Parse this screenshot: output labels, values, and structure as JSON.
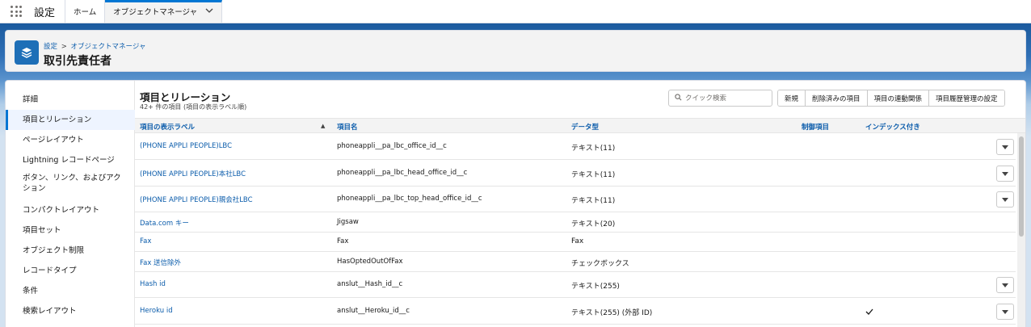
{
  "topnav": {
    "app_name": "設定",
    "tabs": [
      {
        "label": "ホーム"
      },
      {
        "label": "オブジェクトマネージャ"
      }
    ]
  },
  "page": {
    "breadcrumb": {
      "settings": "設定",
      "separator": ">",
      "object_manager": "オブジェクトマネージャ"
    },
    "title": "取引先責任者"
  },
  "sidebar": {
    "items": [
      {
        "label": "詳細"
      },
      {
        "label": "項目とリレーション"
      },
      {
        "label": "ページレイアウト"
      },
      {
        "label": "Lightning レコードページ"
      },
      {
        "label": "ボタン、リンク、およびアクション"
      },
      {
        "label": "コンパクトレイアウト"
      },
      {
        "label": "項目セット"
      },
      {
        "label": "オブジェクト制限"
      },
      {
        "label": "レコードタイプ"
      },
      {
        "label": "条件"
      },
      {
        "label": "検索レイアウト"
      }
    ],
    "active_index": 1
  },
  "section": {
    "title": "項目とリレーション",
    "subtitle": "42+ 件の項目 (項目の表示ラベル順)",
    "search_placeholder": "クイック検索",
    "buttons": {
      "new": "新規",
      "deleted_fields": "削除済みの項目",
      "dependencies": "項目の連動関係",
      "history": "項目履歴管理の設定"
    }
  },
  "table": {
    "columns": {
      "label": "項目の表示ラベル",
      "api_name": "項目名",
      "type": "データ型",
      "controlling": "制御項目",
      "indexed": "インデックス付き"
    },
    "rows": [
      {
        "label": "(PHONE APPLI PEOPLE)LBC",
        "api_name": "phoneappli__pa_lbc_office_id__c",
        "type": "テキスト(11)",
        "indexed": false,
        "has_menu": true
      },
      {
        "label": "(PHONE APPLI PEOPLE)本社LBC",
        "api_name": "phoneappli__pa_lbc_head_office_id__c",
        "type": "テキスト(11)",
        "indexed": false,
        "has_menu": true
      },
      {
        "label": "(PHONE APPLI PEOPLE)親会社LBC",
        "api_name": "phoneappli__pa_lbc_top_head_office_id__c",
        "type": "テキスト(11)",
        "indexed": false,
        "has_menu": true
      },
      {
        "label": "Data.com キー",
        "api_name": "Jigsaw",
        "type": "テキスト(20)",
        "indexed": false,
        "has_menu": false
      },
      {
        "label": "Fax",
        "api_name": "Fax",
        "type": "Fax",
        "indexed": false,
        "has_menu": false
      },
      {
        "label": "Fax 送信除外",
        "api_name": "HasOptedOutOfFax",
        "type": "チェックボックス",
        "indexed": false,
        "has_menu": false
      },
      {
        "label": "Hash id",
        "api_name": "anslut__Hash_id__c",
        "type": "テキスト(255)",
        "indexed": false,
        "has_menu": true
      },
      {
        "label": "Heroku id",
        "api_name": "anslut__Heroku_id__c",
        "type": "テキスト(255) (外部 ID)",
        "indexed": true,
        "has_menu": true
      }
    ]
  },
  "colors": {
    "accent": "#0176d3",
    "link": "#0b5cab",
    "brand_band": "#1b5a9e",
    "object_icon": "#1e6fb7"
  },
  "icons": {
    "app_launcher": "waffle-icon",
    "object": "layers-icon",
    "search": "search-icon",
    "row_menu": "chevron-down-icon",
    "indexed": "check-icon"
  }
}
